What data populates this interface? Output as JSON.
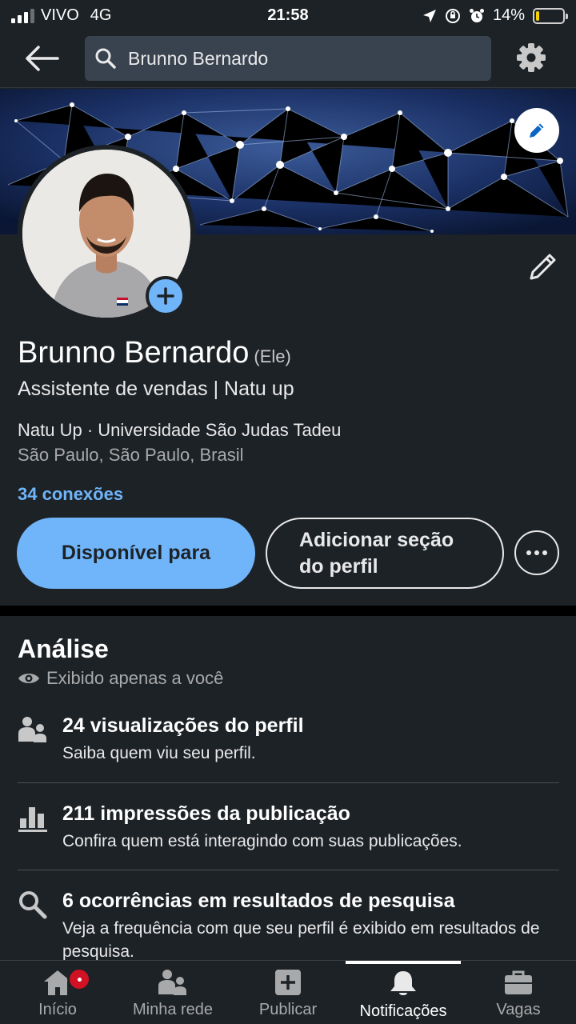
{
  "status_bar": {
    "carrier": "VIVO",
    "network": "4G",
    "time": "21:58",
    "battery_percent": "14%",
    "battery_level": 0.14,
    "battery_color": "#f5cf00"
  },
  "topbar": {
    "search_query": "Brunno Bernardo",
    "back_icon": "arrow-left-icon",
    "settings_icon": "gear-icon"
  },
  "profile": {
    "name": "Brunno Bernardo",
    "pronoun": "(Ele)",
    "headline": "Assistente de vendas | Natu up",
    "org_line": "Natu Up · Universidade São Judas Tadeu",
    "location": "São Paulo, São Paulo, Brasil",
    "connections": "34 conexões",
    "primary_button": "Disponível para",
    "secondary_button_line1": "Adicionar seção",
    "secondary_button_line2": "do perfil",
    "more_icon": "ellipsis-icon"
  },
  "analytics": {
    "title": "Análise",
    "private_note": "Exibido apenas a você",
    "items": [
      {
        "icon": "people-icon",
        "title": "24 visualizações do perfil",
        "subtitle": "Saiba quem viu seu perfil."
      },
      {
        "icon": "bar-chart-icon",
        "title": "211 impressões da publicação",
        "subtitle": "Confira quem está interagindo com suas publicações."
      },
      {
        "icon": "search-icon",
        "title": "6 ocorrências em resultados de pesquisa",
        "subtitle": "Veja a frequência com que seu perfil é exibido em resultados de pesquisa."
      }
    ]
  },
  "bottom_nav": {
    "items": [
      {
        "label": "Início",
        "icon": "home-icon"
      },
      {
        "label": "Minha rede",
        "icon": "network-icon"
      },
      {
        "label": "Publicar",
        "icon": "plus-square-icon"
      },
      {
        "label": "Notificações",
        "icon": "bell-icon"
      },
      {
        "label": "Vagas",
        "icon": "briefcase-icon"
      }
    ],
    "active": "Notificações"
  },
  "colors": {
    "background": "#1d2226",
    "accent": "#70b5f9",
    "badge": "#d11124"
  }
}
